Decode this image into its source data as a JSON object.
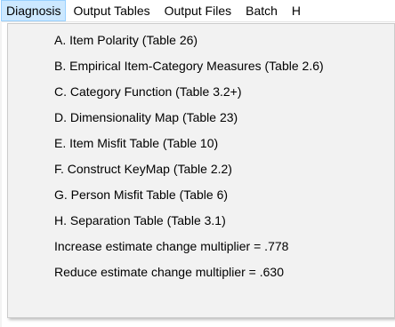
{
  "menubar": {
    "items": [
      {
        "label": "Diagnosis"
      },
      {
        "label": "Output Tables"
      },
      {
        "label": "Output Files"
      },
      {
        "label": "Batch"
      },
      {
        "label": "H"
      }
    ]
  },
  "diagnosis_menu": {
    "items": [
      {
        "label": "A. Item Polarity (Table 26)"
      },
      {
        "label": "B. Empirical Item-Category Measures (Table 2.6)"
      },
      {
        "label": "C. Category Function (Table 3.2+)"
      },
      {
        "label": "D. Dimensionality Map (Table 23)"
      },
      {
        "label": "E. Item Misfit Table (Table 10)"
      },
      {
        "label": "F. Construct KeyMap (Table 2.2)"
      },
      {
        "label": "G. Person Misfit Table (Table 6)"
      },
      {
        "label": "H. Separation Table (Table 3.1)"
      },
      {
        "label": "Increase estimate change multiplier = .778"
      },
      {
        "label": "Reduce estimate change multiplier = .630"
      }
    ]
  },
  "colors": {
    "active_menu_bg": "#cce8ff",
    "active_menu_border": "#99d1ff",
    "dropdown_bg": "#f2f2f2"
  }
}
